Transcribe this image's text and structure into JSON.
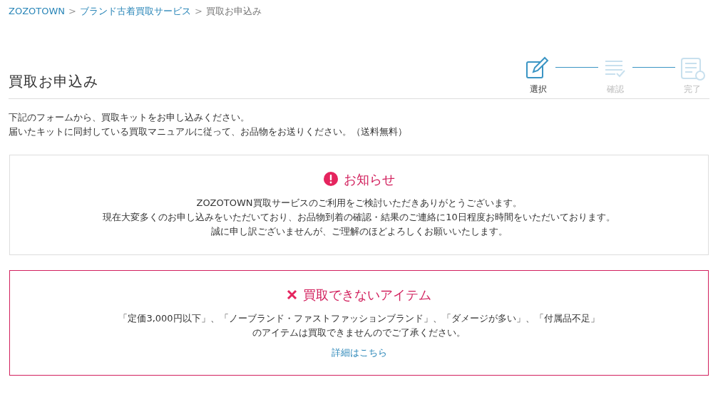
{
  "breadcrumb": [
    {
      "label": "ZOZOTOWN",
      "current": false
    },
    {
      "label": "ブランド古着買取サービス",
      "current": false
    },
    {
      "label": "買取お申込み",
      "current": true
    }
  ],
  "breadcrumb_separator": ">",
  "page_title": "買取お申込み",
  "steps": [
    {
      "label": "選択",
      "selected": true
    },
    {
      "label": "確認",
      "selected": false
    },
    {
      "label": "完了",
      "selected": false
    }
  ],
  "intro": [
    "下記のフォームから、買取キットをお申し込みください。",
    "届いたキットに同封している買取マニュアルに従って、お品物をお送りください。（送料無料）"
  ],
  "notice": {
    "title": "お知らせ",
    "lines": [
      "ZOZOTOWN買取サービスのご利用をご検討いただきありがとうございます。",
      "現在大変多くのお申し込みをいただいており、お品物到着の確認・結果のご連絡に10日程度お時間をいただいております。",
      "誠に申し訳ございませんが、ご理解のほどよろしくお願いいたします。"
    ]
  },
  "restriction": {
    "title": "買取できないアイテム",
    "lines": [
      "「定価3,000円以下」、「ノーブランド・ファストファッションブランド」、「ダメージが多い」、「付属品不足」",
      "のアイテムは買取できませんのでご了承ください。"
    ],
    "link": "詳細はこちら"
  }
}
